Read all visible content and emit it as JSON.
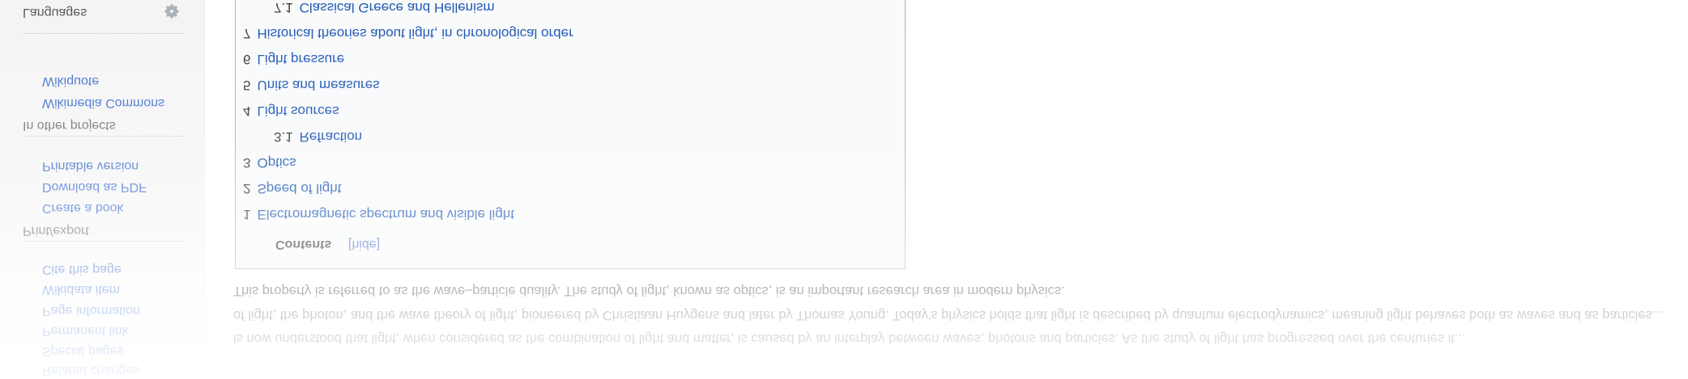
{
  "sidebar": {
    "tools_links": [
      "Related changes",
      "Special pages",
      "Permanent link",
      "Page information",
      "Wikidata item",
      "Cite this page"
    ],
    "print_heading": "Print/export",
    "print_links": [
      "Create a book",
      "Download as PDF",
      "Printable version"
    ],
    "projects_heading": "In other projects",
    "projects_links": [
      "Wikimedia Commons",
      "Wikiquote"
    ],
    "languages_heading": "Languages",
    "gear_icon": "gear-icon"
  },
  "article": {
    "para_line_a": "is now understood that light, when considered as the combination of light and matter, is caused by an interplay between waves, photons and particles. As the study of light has progressed over the centuries it...",
    "para_line_b": "of light, the photon, and the wave theory of light, pioneered by Christiaan Huygens and later by Thomas Young. Today's physics holds that light is described by quantum electrodynamics, meaning light behaves both as waves and as particles...",
    "para_line_c": "This property is referred to as the wave–particle duality. The study of light, known as optics, is an important research area in modern physics."
  },
  "toc": {
    "title": "Contents",
    "hide_label": "[hide]",
    "items": [
      {
        "num": "1",
        "label": "Electromagnetic spectrum and visible light"
      },
      {
        "num": "2",
        "label": "Speed of light"
      },
      {
        "num": "3",
        "label": "Optics"
      },
      {
        "num": "3.1",
        "label": "Refraction"
      },
      {
        "num": "4",
        "label": "Light sources"
      },
      {
        "num": "5",
        "label": "Units and measures"
      },
      {
        "num": "6",
        "label": "Light pressure"
      },
      {
        "num": "7",
        "label": "Historical theories about light, in chronological order"
      },
      {
        "num": "7.1",
        "label": "Classical Greece and Hellenism"
      }
    ]
  },
  "colors": {
    "link": "#3366cc",
    "toc_link": "#0645ad",
    "toc_background": "#f8f9fa",
    "toc_border": "#a2a9b1"
  }
}
